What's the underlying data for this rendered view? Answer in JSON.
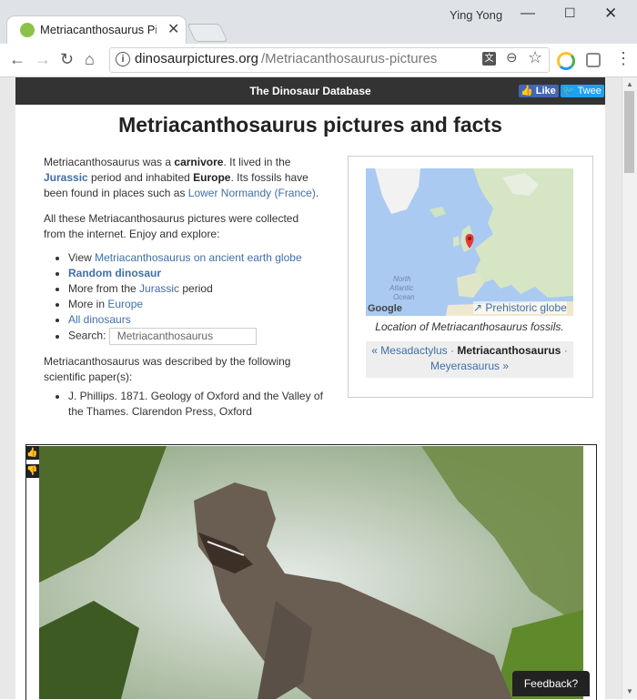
{
  "browser": {
    "tab_title": "Metriacanthosaurus Pic",
    "user": "Ying Yong",
    "url_host": "dinosaurpictures.org",
    "url_path": "/Metriacanthosaurus-pictures"
  },
  "site": {
    "title": "The Dinosaur Database",
    "like": "Like",
    "tweet": "Twee"
  },
  "page": {
    "heading": "Metriacanthosaurus pictures and facts",
    "intro": {
      "p1": "Metriacanthosaurus was a ",
      "diet": "carnivore",
      "p2": ". It lived in the ",
      "period": "Jurassic",
      "p3": " period and inhabited ",
      "region": "Europe",
      "p4": ". Its fossils have been found in places such as ",
      "place": "Lower Normandy (France)",
      "p5": "."
    },
    "intro2": "All these Metriacanthosaurus pictures were collected from the internet. Enjoy and explore:",
    "explore": {
      "view_prefix": "View ",
      "view_link": "Metriacanthosaurus on ancient earth globe",
      "random": "Random dinosaur",
      "more_from_prefix": "More from the ",
      "more_from_link": "Jurassic",
      "more_from_suffix": " period",
      "more_in_prefix": "More in ",
      "more_in_link": "Europe",
      "all": "All dinosaurs",
      "search_label": "Search:",
      "search_value": "Metriacanthosaurus"
    },
    "described": "Metriacanthosaurus was described by the following scientific paper(s):",
    "papers": [
      "J. Phillips. 1871. Geology of Oxford and the Valley of the Thames. Clarendon Press, Oxford"
    ],
    "map": {
      "google": "Google",
      "prehistoric": "↗ Prehistoric globe",
      "caption": "Location of Metriacanthosaurus fossils.",
      "labels": [
        "North",
        "Atlantic",
        "Ocean"
      ]
    },
    "nav": {
      "prev": "« Mesadactylus",
      "sep": " · ",
      "current": "Metriacanthosaurus",
      "next": "Meyerasaurus »"
    },
    "feedback": "Feedback?"
  }
}
